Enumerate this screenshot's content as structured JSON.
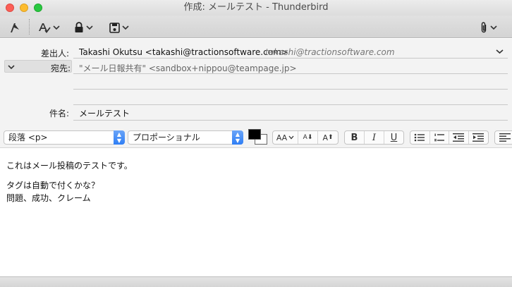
{
  "window": {
    "title": "作成: メールテスト - Thunderbird"
  },
  "toolbar": {
    "send_icon": "send-icon",
    "spelling_icon": "spelling-icon",
    "security_icon": "lock-icon",
    "save_icon": "save-icon",
    "attach_icon": "paperclip-icon"
  },
  "header": {
    "from_label": "差出人:",
    "from_value": "Takashi Okutsu <takashi@tractionsoftware.com>",
    "from_identity": "takashi@tractionsoftware.com",
    "address_type": "宛先:",
    "address_value": "\"メール日報共有\" <sandbox+nippou@teampage.jp>",
    "subject_label": "件名:",
    "subject_value": "メールテスト"
  },
  "format": {
    "paragraph_format": "段落 <p>",
    "font": "プロポーショナル",
    "text_color": "#000000",
    "background_color": "#ffffff",
    "font_size_label": "AA",
    "smaller_label": "A",
    "larger_label": "A",
    "bold_label": "B",
    "italic_label": "I",
    "underline_label": "U"
  },
  "body": {
    "line1": "これはメール投稿のテストです。",
    "line2": "タグは自動で付くかな？",
    "line3": "問題、成功、クレーム"
  }
}
